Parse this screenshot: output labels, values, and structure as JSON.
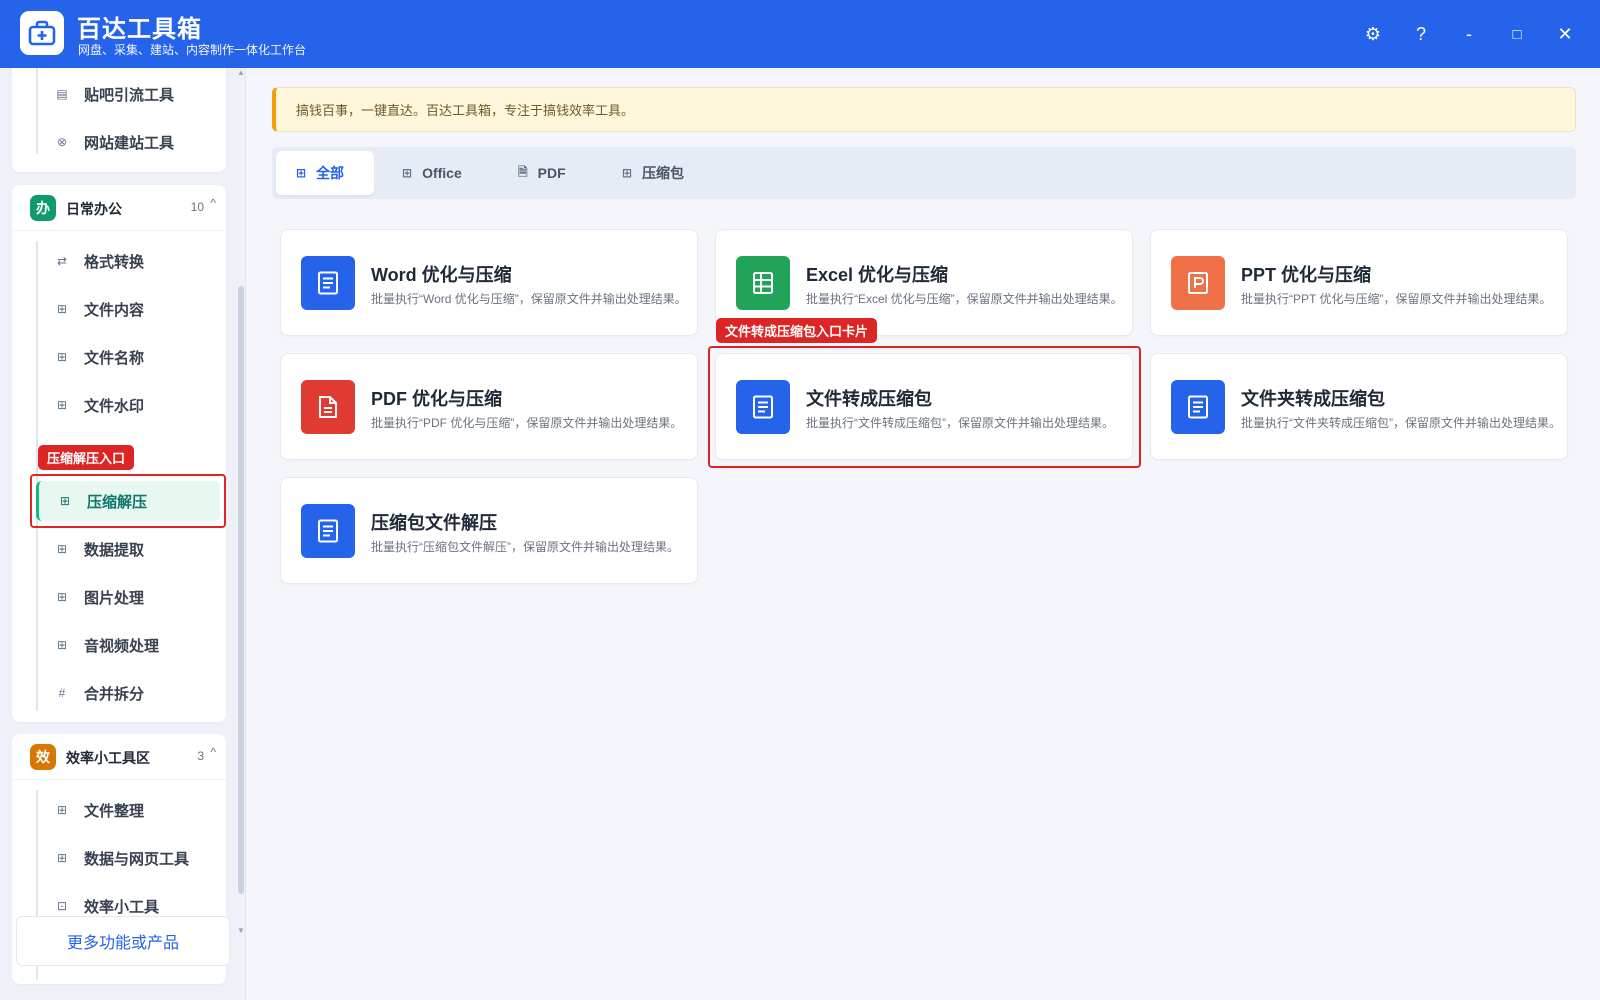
{
  "app": {
    "title": "百达工具箱",
    "subtitle": "网盘、采集、建站、内容制作一体化工作台",
    "brand_color": "#2563eb"
  },
  "window_controls": {
    "settings": "⚙",
    "help": "?",
    "minimize": "-",
    "maximize": "□",
    "close": "✕"
  },
  "sidebar": {
    "top_group": {
      "items": [
        {
          "label": "贴吧引流工具",
          "icon": "post-icon"
        },
        {
          "label": "网站建站工具",
          "icon": "globe-icon"
        }
      ]
    },
    "office_group": {
      "badge": "办",
      "badge_color": "#0f9b6e",
      "title": "日常办公",
      "count": "10",
      "caret": "^",
      "items": [
        {
          "label": "格式转换",
          "icon": "swap-icon"
        },
        {
          "label": "文件内容",
          "icon": "grid-icon"
        },
        {
          "label": "文件名称",
          "icon": "grid-icon"
        },
        {
          "label": "文件水印",
          "icon": "grid-icon"
        },
        {
          "label": "压缩解压",
          "icon": "grid-icon",
          "active": true
        },
        {
          "label": "数据提取",
          "icon": "grid-icon"
        },
        {
          "label": "图片处理",
          "icon": "grid-icon"
        },
        {
          "label": "音视频处理",
          "icon": "grid-icon"
        },
        {
          "label": "合并拆分",
          "icon": "hash-icon"
        }
      ]
    },
    "efficiency_group": {
      "badge": "效",
      "badge_color": "#d97706",
      "title": "效率小工具区",
      "count": "3",
      "caret": "^",
      "items": [
        {
          "label": "文件整理",
          "icon": "grid-icon"
        },
        {
          "label": "数据与网页工具",
          "icon": "grid-icon"
        },
        {
          "label": "效率小工具",
          "icon": "toolbox-icon"
        }
      ]
    },
    "more_button": "更多功能或产品",
    "annotation": "压缩解压入口"
  },
  "notice": "搞钱百事，一键直达。百达工具箱，专注于搞钱效率工具。",
  "tabs": [
    {
      "label": "全部",
      "icon": "grid-icon",
      "active": true
    },
    {
      "label": "Office",
      "icon": "grid-icon"
    },
    {
      "label": "PDF",
      "icon": "file-icon"
    },
    {
      "label": "压缩包",
      "icon": "grid-icon"
    }
  ],
  "cards": [
    {
      "title": "Word 优化与压缩",
      "desc": "批量执行“Word 优化与压缩”，保留原文件并输出处理结果。",
      "icon": "document-icon",
      "color": "#2563eb"
    },
    {
      "title": "Excel 优化与压缩",
      "desc": "批量执行“Excel 优化与压缩”，保留原文件并输出处理结果。",
      "icon": "sheet-icon",
      "color": "#22a35a"
    },
    {
      "title": "PPT 优化与压缩",
      "desc": "批量执行“PPT 优化与压缩”，保留原文件并输出处理结果。",
      "icon": "slides-icon",
      "color": "#f07048"
    },
    {
      "title": "PDF 优化与压缩",
      "desc": "批量执行“PDF 优化与压缩”，保留原文件并输出处理结果。",
      "icon": "pdf-icon",
      "color": "#e03a32"
    },
    {
      "title": "文件转成压缩包",
      "desc": "批量执行“文件转成压缩包”，保留原文件并输出处理结果。",
      "icon": "document-icon",
      "color": "#2563eb"
    },
    {
      "title": "文件夹转成压缩包",
      "desc": "批量执行“文件夹转成压缩包”，保留原文件并输出处理结果。",
      "icon": "document-icon",
      "color": "#2563eb"
    },
    {
      "title": "压缩包文件解压",
      "desc": "批量执行“压缩包文件解压”，保留原文件并输出处理结果。",
      "icon": "document-icon",
      "color": "#2563eb"
    }
  ],
  "card_annotation": "文件转成压缩包入口卡片"
}
